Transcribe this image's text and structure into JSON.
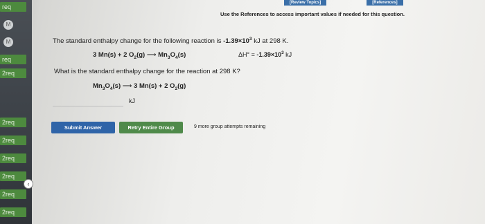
{
  "topbar": {
    "review_topics": "[Review Topics]",
    "references": "[References]"
  },
  "ref_note": "Use the References to access important values if needed for this question.",
  "sidebar": {
    "items": [
      {
        "label": "req",
        "type": "tab"
      },
      {
        "label": "M",
        "type": "circle"
      },
      {
        "label": "M",
        "type": "circle"
      },
      {
        "label": "req",
        "type": "tab"
      },
      {
        "label": "2req",
        "type": "tab"
      },
      {
        "label": "2req",
        "type": "tab"
      },
      {
        "label": "2req",
        "type": "tab"
      },
      {
        "label": "2req",
        "type": "tab"
      },
      {
        "label": "2req",
        "type": "tab"
      },
      {
        "label": "2req",
        "type": "tab"
      },
      {
        "label": "2req",
        "type": "tab"
      }
    ],
    "collapse_icon": "chevron-left-icon"
  },
  "question": {
    "intro_pre": "The standard enthalpy change for the following reaction is ",
    "dh_value_bold": "-1.39×10",
    "dh_exp": "3",
    "intro_post": " kJ at 298 K.",
    "reaction1": {
      "lhs_a": "3 Mn(s) + 2 O",
      "lhs_sub": "2",
      "lhs_b": "(g)",
      "arrow": "⟶",
      "rhs_a": "Mn",
      "rhs_sub1": "3",
      "rhs_b": "O",
      "rhs_sub2": "4",
      "rhs_c": "(s)"
    },
    "dh_label": "ΔH° = ",
    "dh_unit": " kJ",
    "prompt": "What is the standard enthalpy change for the reaction at 298 K?",
    "reaction2": {
      "lhs_a": "Mn",
      "lhs_sub1": "3",
      "lhs_b": "O",
      "lhs_sub2": "4",
      "lhs_c": "(s)",
      "arrow": "⟶",
      "rhs_a": "3 Mn(s) + 2 O",
      "rhs_sub": "2",
      "rhs_b": "(g)"
    },
    "answer_value": "",
    "answer_unit": "kJ"
  },
  "actions": {
    "submit_label": "Submit Answer",
    "retry_label": "Retry Entire Group",
    "attempts_text": "9 more group attempts remaining"
  }
}
